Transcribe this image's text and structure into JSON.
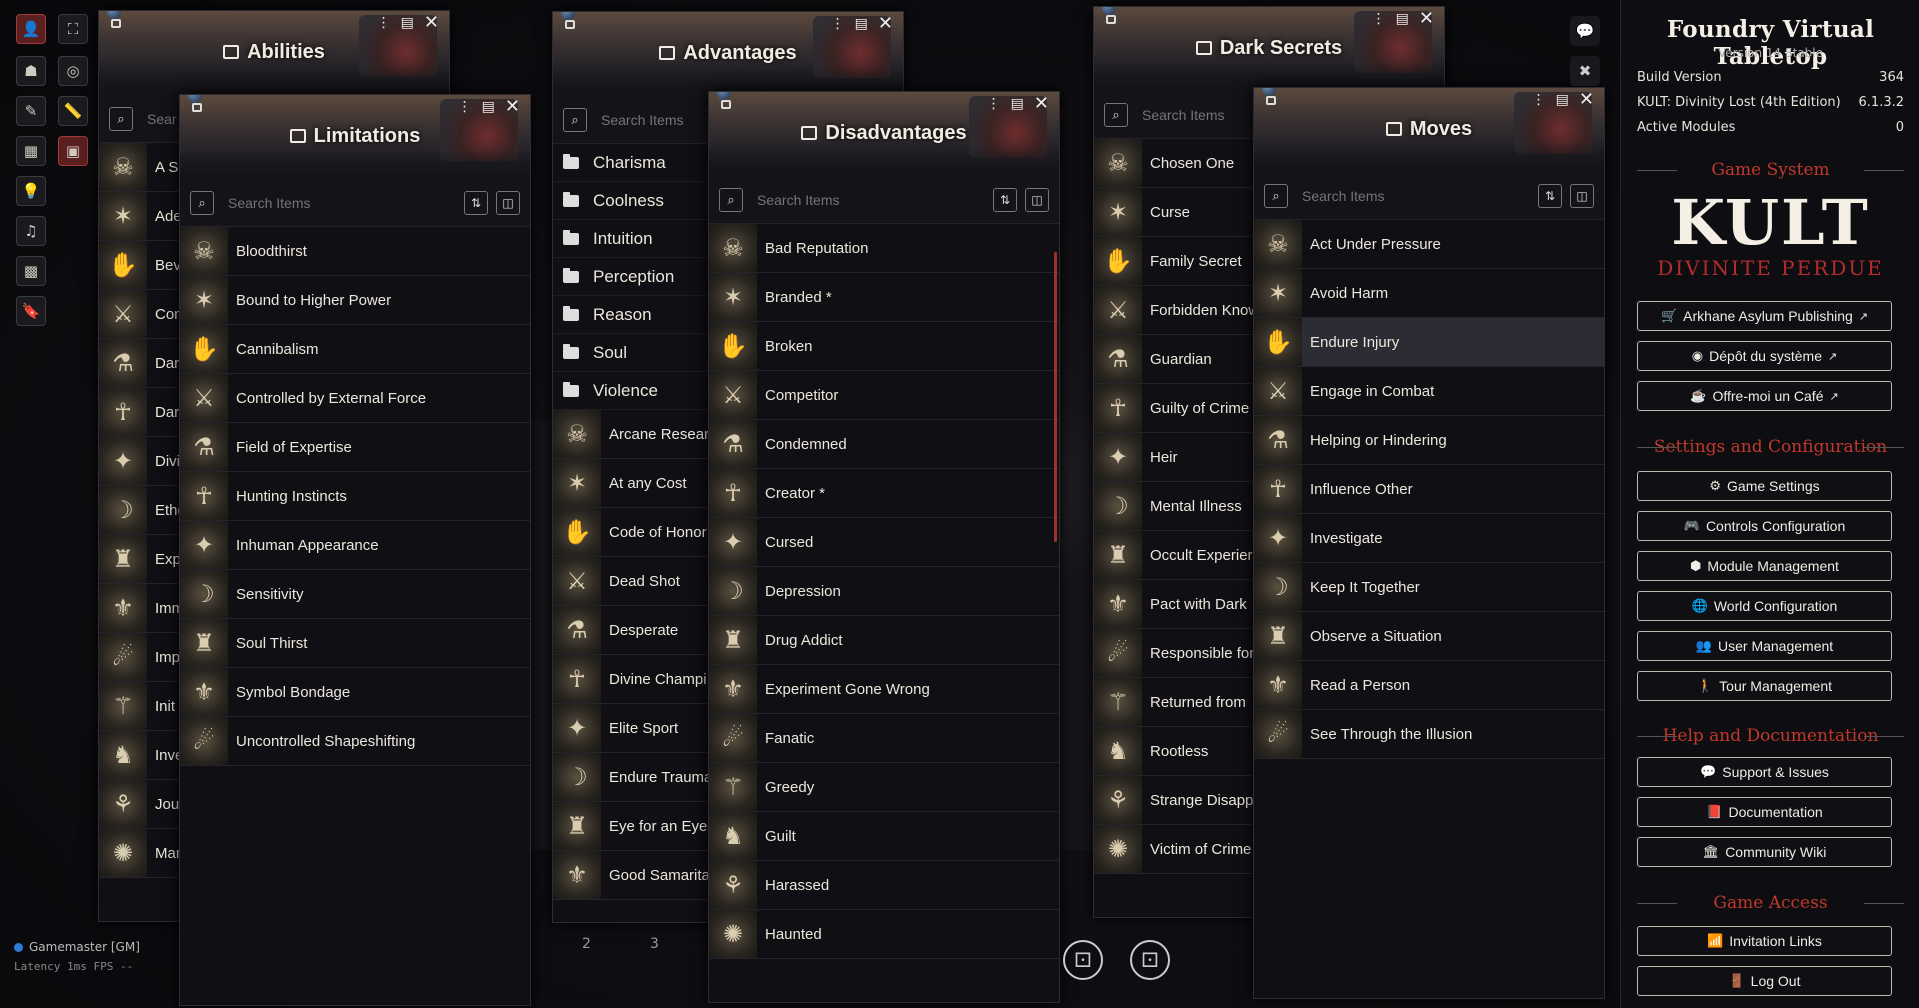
{
  "colors": {
    "accent": "#c0392b",
    "brand_red": "#b32d2d",
    "bg": "#0f0f14",
    "text": "#ece7dc"
  },
  "search_placeholder": "Search Items",
  "left_controls": [
    "token-icon",
    "fullscreen-icon",
    "users-icon",
    "target-icon",
    "pencil-icon",
    "ruler-icon",
    "tiles-icon",
    "bag-icon",
    "lightbulb-icon",
    "music-icon",
    "grid-icon",
    "bookmark-icon"
  ],
  "abilities": {
    "title": "Abilities",
    "search": "Sear",
    "items": [
      "A Se",
      "Ade",
      "Bev",
      "Com",
      "Dar",
      "Dar",
      "Divi",
      "Ethe",
      "Exp",
      "Imm",
      "Imp",
      "Init",
      "Inve",
      "Jour",
      "Mar"
    ]
  },
  "limitations": {
    "title": "Limitations",
    "items": [
      "Bloodthirst",
      "Bound to Higher Power",
      "Cannibalism",
      "Controlled by External Force",
      "Field of Expertise",
      "Hunting Instincts",
      "Inhuman Appearance",
      "Sensitivity",
      "Soul Thirst",
      "Symbol Bondage",
      "Uncontrolled Shapeshifting"
    ]
  },
  "advantages": {
    "title": "Advantages",
    "folders": [
      "Charisma",
      "Coolness",
      "Intuition",
      "Perception",
      "Reason",
      "Soul",
      "Violence"
    ],
    "items": [
      "Arcane Researc",
      "At any Cost",
      "Code of Honor",
      "Dead Shot",
      "Desperate",
      "Divine Champi",
      "Elite Sport",
      "Endure Trauma",
      "Eye for an Eye",
      "Good Samarita"
    ]
  },
  "disadvantages": {
    "title": "Disadvantages",
    "items": [
      "Bad Reputation",
      "Branded *",
      "Broken",
      "Competitor",
      "Condemned",
      "Creator *",
      "Cursed",
      "Depression",
      "Drug Addict",
      "Experiment Gone Wrong",
      "Fanatic",
      "Greedy",
      "Guilt",
      "Harassed",
      "Haunted"
    ]
  },
  "dark_secrets": {
    "title": "Dark Secrets",
    "items": [
      "Chosen One",
      "Curse",
      "Family Secret",
      "Forbidden Know",
      "Guardian",
      "Guilty of Crime",
      "Heir",
      "Mental Illness",
      "Occult Experier",
      "Pact with Dark",
      "Responsible for",
      "Returned from",
      "Rootless",
      "Strange Disapp",
      "Victim of Crime"
    ]
  },
  "moves": {
    "title": "Moves",
    "items": [
      "Act Under Pressure",
      "Avoid Harm",
      "Endure Injury",
      "Engage in Combat",
      "Helping or Hindering",
      "Influence Other",
      "Investigate",
      "Keep It Together",
      "Observe a Situation",
      "Read a Person",
      "See Through the Illusion"
    ],
    "highlighted": "Endure Injury"
  },
  "sidebar": {
    "title": "Foundry Virtual Tabletop",
    "version": "Version 14 Stable",
    "rows": [
      {
        "label": "Build Version",
        "value": "364"
      },
      {
        "label": "KULT: Divinity Lost (4th Edition)",
        "value": "6.1.3.2"
      },
      {
        "label": "Active Modules",
        "value": "0"
      }
    ],
    "game_system_heading": "Game System",
    "logo_main": "KULT",
    "logo_sub": "DIVINITE PERDUE",
    "system_links": [
      "Arkhane Asylum Publishing",
      "Dépôt du système",
      "Offre-moi un Café"
    ],
    "settings_heading": "Settings and Configuration",
    "settings_buttons": [
      "Game Settings",
      "Controls Configuration",
      "Module Management",
      "World Configuration",
      "User Management",
      "Tour Management"
    ],
    "help_heading": "Help and Documentation",
    "help_buttons": [
      "Support & Issues",
      "Documentation",
      "Community Wiki"
    ],
    "access_heading": "Game Access",
    "access_buttons": [
      "Invitation Links",
      "Log Out"
    ]
  },
  "player": {
    "name": "Gamemaster [GM]",
    "latency": "Latency  1ms  FPS  --"
  },
  "hotbar": [
    "2",
    "3"
  ]
}
